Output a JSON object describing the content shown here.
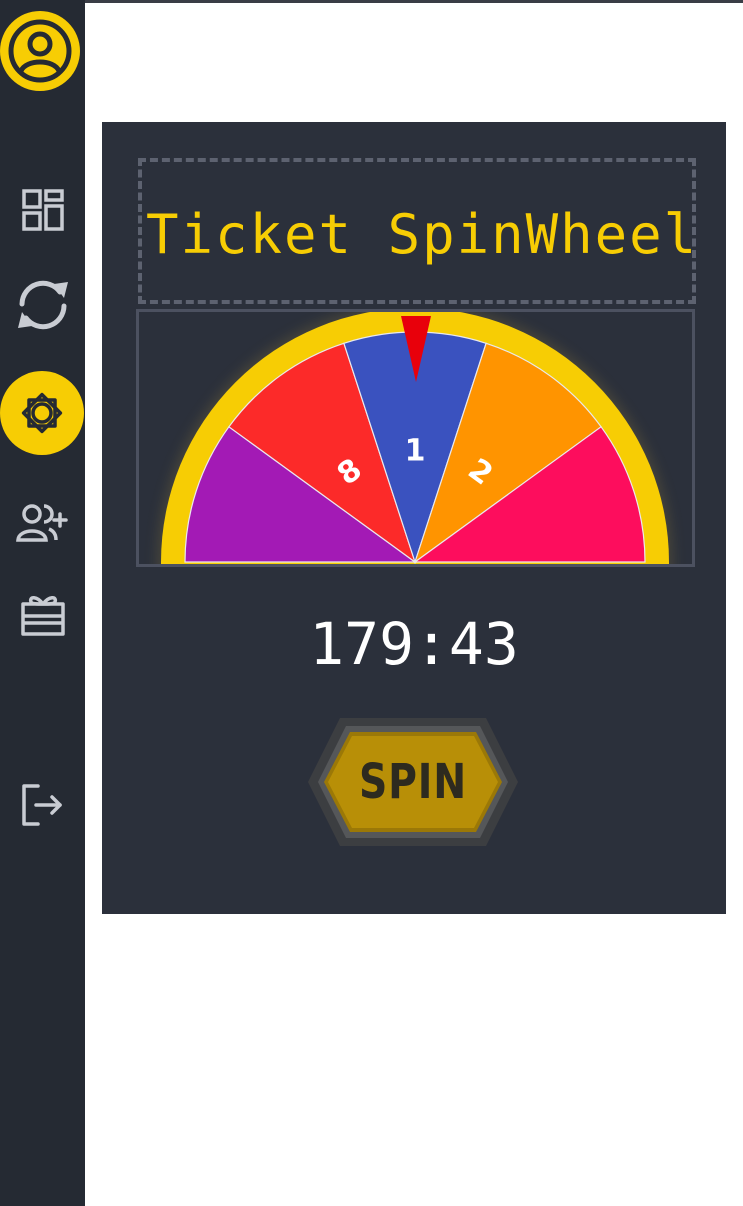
{
  "sidebar": {
    "avatar_icon": "user-circle-icon",
    "items": [
      {
        "icon": "dashboard-grid-icon",
        "active": false
      },
      {
        "icon": "refresh-icon",
        "active": false
      },
      {
        "icon": "spin-wheel-badge-icon",
        "active": true
      },
      {
        "icon": "add-user-icon",
        "active": false
      },
      {
        "icon": "gift-box-icon",
        "active": false
      }
    ],
    "logout_icon": "logout-icon"
  },
  "main": {
    "marquee_text": "Ticket SpinWheel Re",
    "wheel": {
      "pointer_color": "#e8000b",
      "rim_color": "#f7cd04",
      "segments": [
        {
          "label": "",
          "color": "#a31ab5"
        },
        {
          "label": "8",
          "color": "#fc2a29"
        },
        {
          "label": "1",
          "color": "#3a52bf"
        },
        {
          "label": "2",
          "color": "#ff9400"
        },
        {
          "label": "",
          "color": "#fd0d5d"
        }
      ]
    },
    "timer": "179:43",
    "spin_button_label": "SPIN"
  },
  "colors": {
    "sidebar_bg": "#252a33",
    "panel_bg": "#2b303b",
    "accent": "#f7cd04"
  }
}
